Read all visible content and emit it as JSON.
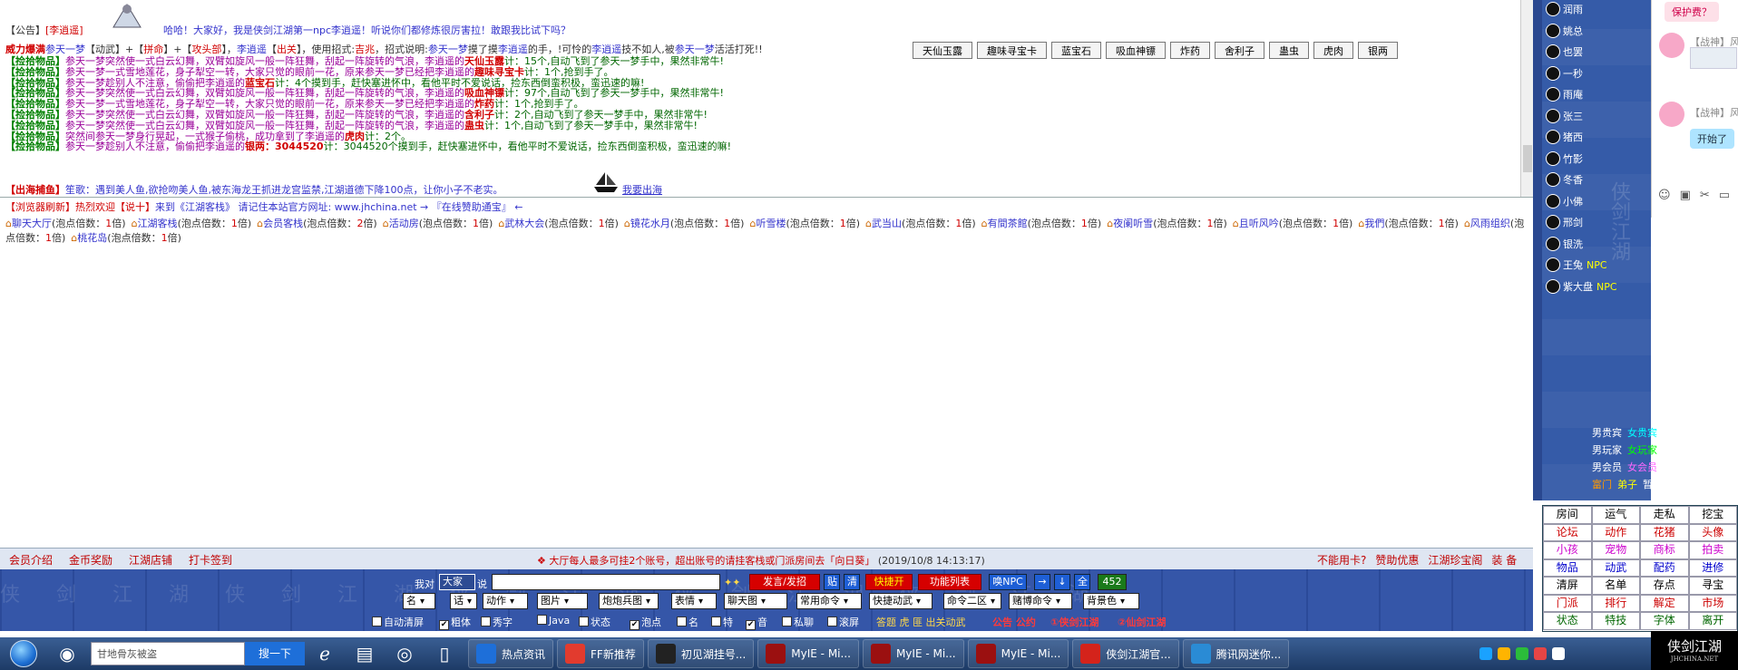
{
  "chat": {
    "announce_label": "【公告】",
    "announce_npc": "[李逍遥]",
    "announce_text": "哈哈！大家好，我是侠剑江湖第一npc李逍遥！听说你们都修炼很厉害拉！敢跟我比试下吗？",
    "battle_prefix": "威力爆满",
    "battle_player": "参天一梦",
    "battle_tags": "【动武】+【",
    "battle_tag_red": "拼命",
    "battle_tags2": "】+【",
    "battle_tag_red2": "攻头部",
    "battle_tags3": "】，",
    "battle_npc": "李逍遥",
    "battle_tag4": "【",
    "battle_tag_red4": "出关",
    "battle_text1": "】，使用招式:",
    "battle_move": "吉兆",
    "battle_text2": "，招式说明:",
    "battle_text3": "摸了摸",
    "battle_text4": "的手，!可怜的",
    "battle_text5": "技不如人,被",
    "battle_text6": "活活打死!!",
    "pickup_label": "【捡拾物品】",
    "pickup_lines": [
      {
        "text": "参天一梦突然使一式白云幻舞，双臂如旋风一般一阵狂舞，刮起一阵旋转的气浪，李逍遥的",
        "item": "天仙玉露",
        "tail": "计：15个,自动飞到了参天一梦手中，果然非常牛!"
      },
      {
        "text": "参天一梦一式雪地莲花，身子犁空一转，大家只觉的眼前一花，原来参天一梦已经把李逍遥的",
        "item": "趣味寻宝卡",
        "tail": "计：1个,抢到手了。"
      },
      {
        "text": "参天一梦趁别人不注意，偷偷把李逍遥的",
        "item": "蓝宝石",
        "tail": "计：4个摸到手，赶快塞进怀中，看他平时不爱说话，捡东西倒蛮积极，蛮迅速的嘛!"
      },
      {
        "text": "参天一梦突然使一式白云幻舞，双臂如旋风一般一阵狂舞，刮起一阵旋转的气浪，李逍遥的",
        "item": "吸血神镖",
        "tail": "计：97个,自动飞到了参天一梦手中，果然非常牛!"
      },
      {
        "text": "参天一梦一式雪地莲花，身子犁空一转，大家只觉的眼前一花，原来参天一梦已经把李逍遥的",
        "item": "炸药",
        "tail": "计：1个,抢到手了。"
      },
      {
        "text": "参天一梦突然使一式白云幻舞，双臂如旋风一般一阵狂舞，刮起一阵旋转的气浪，李逍遥的",
        "item": "含利子",
        "tail": "计：2个,自动飞到了参天一梦手中，果然非常牛!"
      },
      {
        "text": "参天一梦突然使一式白云幻舞，双臂如旋风一般一阵狂舞，刮起一阵旋转的气浪，李逍遥的",
        "item": "蛊虫",
        "tail": "计：1个,自动飞到了参天一梦手中，果然非常牛!"
      },
      {
        "text": "突然间参天一梦身行晃起，一式猴子偷桃，成功拿到了李逍遥的",
        "item": "虎肉",
        "tail": "计：2个。"
      },
      {
        "text": "参天一梦趁别人不注意，偷偷把李逍遥的",
        "item": "银两：3044520",
        "tail": "计：3044520个摸到手，赶快塞进怀中，看他平时不爱说话，捡东西倒蛮积极，蛮迅速的嘛!"
      }
    ],
    "sea_label": "【出海捕鱼】",
    "sea_text": "笙歌：遇到美人鱼,欲抢吻美人鱼,被东海龙王抓进龙宫监禁,江湖道德下降100点，让你小子不老实。",
    "sea_link": "我要出海"
  },
  "item_buttons": [
    "天仙玉露",
    "趣味寻宝卡",
    "蓝宝石",
    "吸血神镖",
    "炸药",
    "舍利子",
    "蛊虫",
    "虎肉",
    "银两"
  ],
  "lower": {
    "refresh_label": "【浏览器刷新】",
    "welcome1": "热烈欢迎",
    "welcome_name": "【说十】",
    "welcome2": "来到《江湖客栈》 请记住本站官方网址: www.jhchina.net  →  『在线赞助通宝』  ←",
    "rooms": [
      {
        "name": "聊天大厅",
        "mult": "1"
      },
      {
        "name": "江湖客栈",
        "mult": "1"
      },
      {
        "name": "会员客栈",
        "mult": "2"
      },
      {
        "name": "活动房",
        "mult": "1"
      },
      {
        "name": "武林大会",
        "mult": "1"
      },
      {
        "name": "镜花水月",
        "mult": "1"
      },
      {
        "name": "听雪楼",
        "mult": "1"
      },
      {
        "name": "武当山",
        "mult": "1"
      },
      {
        "name": "有間茶館",
        "mult": "1"
      },
      {
        "name": "夜阑听雪",
        "mult": "1"
      },
      {
        "name": "且听风吟",
        "mult": "1"
      },
      {
        "name": "我們",
        "mult": "1"
      },
      {
        "name": "风雨组织",
        "mult": "1"
      },
      {
        "name": "桃花岛",
        "mult": "1"
      }
    ],
    "mult_prefix": "(泡点倍数：",
    "mult_suffix": "倍)"
  },
  "info_bar": {
    "left": [
      "会员介绍",
      "金币奖励",
      "江湖店铺",
      "打卡签到"
    ],
    "notice": "大厅每人最多可挂2个账号，超出账号的请挂客栈或门派房间去「向日葵」",
    "date": "(2019/10/8 14:13:17)",
    "right": [
      "不能用卡?",
      "赞助优惠",
      "江湖珍宝阁",
      "装 备"
    ]
  },
  "controls": {
    "to_label": "我对",
    "target": "大家",
    "say_label": "说",
    "message_value": "",
    "send": "发言/发招",
    "paste": "贴",
    "clear": "清",
    "quick": "快捷开",
    "func_list": "功能列表",
    "npc": "唤NPC",
    "count": "452",
    "selects": [
      "名",
      "话",
      "动作",
      "图片",
      "炮炮兵图",
      "表情",
      "聊天图",
      "常用命令",
      "快捷动武",
      "命令二区",
      "赌博命令",
      "背景色"
    ],
    "checks": [
      {
        "label": "自动清屏",
        "checked": false
      },
      {
        "label": "粗体",
        "checked": true
      },
      {
        "label": "秀字",
        "checked": false
      },
      {
        "label": "Java",
        "checked": false
      },
      {
        "label": "状态",
        "checked": false
      },
      {
        "label": "泡点",
        "checked": true
      },
      {
        "label": "名",
        "checked": false
      },
      {
        "label": "特",
        "checked": false
      },
      {
        "label": "音",
        "checked": true
      },
      {
        "label": "私聊",
        "checked": false
      },
      {
        "label": "滚屏",
        "checked": false
      }
    ],
    "extra_yellow": "答题  虎  匪  出关动武",
    "extra_red": "公告  公约",
    "link1": "①侠剑江湖",
    "link2": "②仙剑江湖"
  },
  "right_panel": {
    "users": [
      {
        "name": "润雨",
        "npc": false
      },
      {
        "name": "姚总",
        "npc": false
      },
      {
        "name": "也罢",
        "npc": false
      },
      {
        "name": "一秒",
        "npc": false
      },
      {
        "name": "雨庵",
        "npc": false
      },
      {
        "name": "张三",
        "npc": false
      },
      {
        "name": "猪西",
        "npc": false
      },
      {
        "name": "竹影",
        "npc": false
      },
      {
        "name": "冬香",
        "npc": false
      },
      {
        "name": "小佛",
        "npc": false
      },
      {
        "name": "邢剑",
        "npc": false
      },
      {
        "name": "银洗",
        "npc": false
      },
      {
        "name": "王兔",
        "npc": true
      },
      {
        "name": "紫大盘",
        "npc": true
      }
    ],
    "npc_label": "NPC",
    "legend": [
      [
        {
          "t": "男贵宾",
          "c": "#ffffff"
        },
        {
          "t": "女贵宾",
          "c": "#00ffff"
        }
      ],
      [
        {
          "t": "男玩家",
          "c": "#ffffff"
        },
        {
          "t": "女玩家",
          "c": "#00ff00"
        }
      ],
      [
        {
          "t": "男会员",
          "c": "#ffffff"
        },
        {
          "t": "女会员",
          "c": "#ff66ff"
        }
      ],
      [
        {
          "t": "富门",
          "c": "#ff9900"
        },
        {
          "t": "弟子",
          "c": "#ffff00"
        },
        {
          "t": "暂离",
          "c": "#ffffff"
        }
      ]
    ]
  },
  "func_grid": [
    {
      "t": "房间",
      "c": "#000000"
    },
    {
      "t": "运气",
      "c": "#000000"
    },
    {
      "t": "走私",
      "c": "#000000"
    },
    {
      "t": "挖宝",
      "c": "#000000"
    },
    {
      "t": "论坛",
      "c": "#cc0000"
    },
    {
      "t": "动作",
      "c": "#cc0000"
    },
    {
      "t": "花猪",
      "c": "#cc0000"
    },
    {
      "t": "头像",
      "c": "#cc0000"
    },
    {
      "t": "小孩",
      "c": "#cc00cc"
    },
    {
      "t": "宠物",
      "c": "#cc00cc"
    },
    {
      "t": "商标",
      "c": "#cc00cc"
    },
    {
      "t": "拍卖",
      "c": "#cc00cc"
    },
    {
      "t": "物品",
      "c": "#0000cc"
    },
    {
      "t": "动武",
      "c": "#0000cc"
    },
    {
      "t": "配药",
      "c": "#0000cc"
    },
    {
      "t": "进修",
      "c": "#0000cc"
    },
    {
      "t": "清屏",
      "c": "#000000"
    },
    {
      "t": "名单",
      "c": "#000000"
    },
    {
      "t": "存点",
      "c": "#000000"
    },
    {
      "t": "寻宝",
      "c": "#000000"
    },
    {
      "t": "门派",
      "c": "#cc0000"
    },
    {
      "t": "排行",
      "c": "#cc0000"
    },
    {
      "t": "解定",
      "c": "#cc0000"
    },
    {
      "t": "市场",
      "c": "#cc0000"
    },
    {
      "t": "状态",
      "c": "#006600"
    },
    {
      "t": "特技",
      "c": "#006600"
    },
    {
      "t": "字体",
      "c": "#006600"
    },
    {
      "t": "离开",
      "c": "#006600"
    }
  ],
  "qq": {
    "bubble1": "保护费？",
    "name": "【战神】风风风",
    "bubble2": "开始了"
  },
  "logo": {
    "title": "侠剑江湖",
    "url": "JHCHINA.NET"
  },
  "taskbar": {
    "search_value": "甘地骨灰被盗",
    "search_go": "搜一下",
    "apps": [
      "热点资讯",
      "FF新推荐",
      "初见湖挂号...",
      "MyIE - Mi...",
      "MyIE - Mi...",
      "MyIE - Mi...",
      "侠剑江湖官...",
      "腾讯网迷你..."
    ]
  }
}
